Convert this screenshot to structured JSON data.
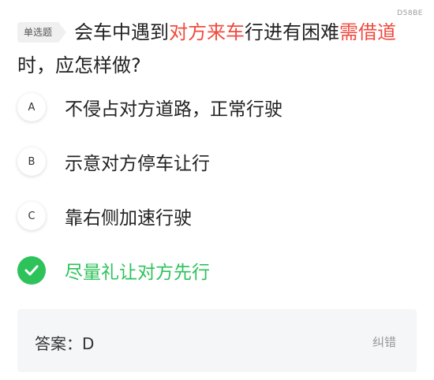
{
  "question_code": "D58BE",
  "question": {
    "type_label": "单选题",
    "segments": [
      {
        "text": "会车中遇到",
        "highlight": false
      },
      {
        "text": "对方来车",
        "highlight": true
      },
      {
        "text": "行进有困难",
        "highlight": false
      },
      {
        "text": "需借道",
        "highlight": true
      },
      {
        "text": "时，应怎样做?",
        "highlight": false
      }
    ]
  },
  "options": [
    {
      "letter": "A",
      "text": "不侵占对方道路，正常行驶",
      "correct": false
    },
    {
      "letter": "B",
      "text": "示意对方停车让行",
      "correct": false
    },
    {
      "letter": "C",
      "text": "靠右侧加速行驶",
      "correct": false
    },
    {
      "letter": "D",
      "text": "尽量礼让对方先行",
      "correct": true
    }
  ],
  "answer": {
    "label": "答案：",
    "value": "D",
    "report_label": "纠错"
  },
  "icons": {
    "correct_option": "check-icon"
  },
  "colors": {
    "highlight": "#f04a3e",
    "correct": "#2ec25b",
    "badge_bg": "#f0f0f0",
    "answer_bg": "#f5f6f7"
  }
}
